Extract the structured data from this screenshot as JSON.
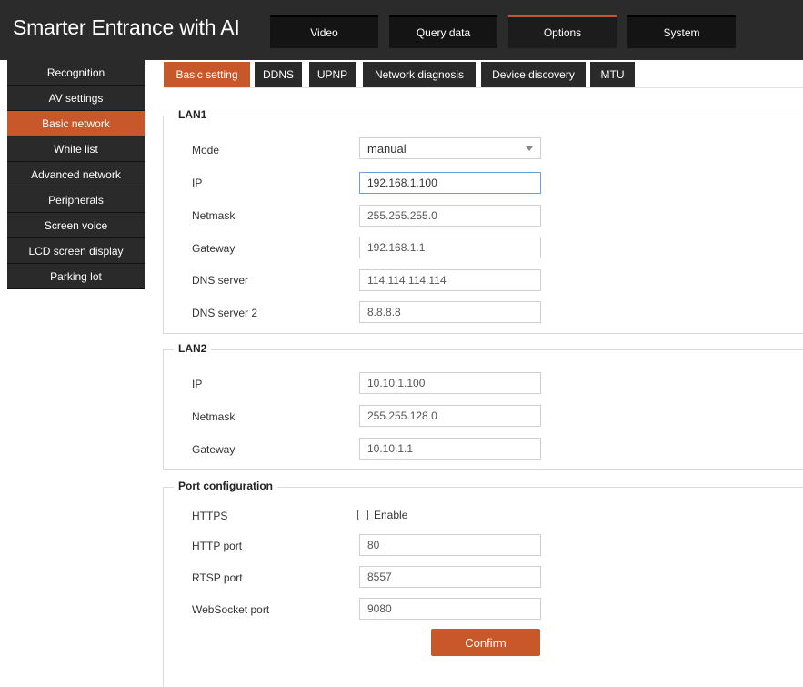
{
  "header": {
    "title": "Smarter Entrance with AI",
    "tabs": [
      "Video",
      "Query data",
      "Options",
      "System"
    ],
    "active_tab": "Options",
    "accent_color": "#c8582a"
  },
  "sidebar": {
    "items": [
      "Recognition",
      "AV settings",
      "Basic network",
      "White list",
      "Advanced network",
      "Peripherals",
      "Screen voice",
      "LCD screen display",
      "Parking lot"
    ],
    "active": "Basic network"
  },
  "subtabs": {
    "items": [
      "Basic setting",
      "DDNS",
      "UPNP",
      "Network diagnosis",
      "Device discovery",
      "MTU"
    ],
    "active": "Basic setting"
  },
  "lan1": {
    "legend": "LAN1",
    "mode_label": "Mode",
    "mode_value": "manual",
    "ip_label": "IP",
    "ip_value": "192.168.1.100",
    "netmask_label": "Netmask",
    "netmask_value": "255.255.255.0",
    "gateway_label": "Gateway",
    "gateway_value": "192.168.1.1",
    "dns_label": "DNS server",
    "dns_value": "114.114.114.114",
    "dns2_label": "DNS server 2",
    "dns2_value": "8.8.8.8"
  },
  "lan2": {
    "legend": "LAN2",
    "ip_label": "IP",
    "ip_value": "10.10.1.100",
    "netmask_label": "Netmask",
    "netmask_value": "255.255.128.0",
    "gateway_label": "Gateway",
    "gateway_value": "10.10.1.1"
  },
  "ports": {
    "legend": "Port configuration",
    "https_label": "HTTPS",
    "https_enable_label": "Enable",
    "https_enabled": false,
    "http_label": "HTTP port",
    "http_value": "80",
    "rtsp_label": "RTSP port",
    "rtsp_value": "8557",
    "ws_label": "WebSocket port",
    "ws_value": "9080"
  },
  "confirm_label": "Confirm"
}
